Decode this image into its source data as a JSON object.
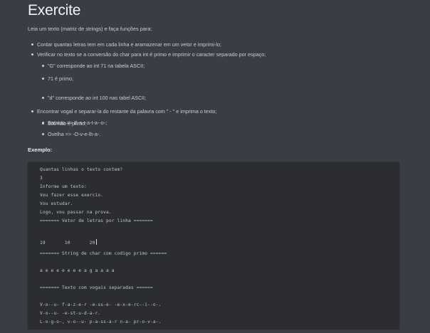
{
  "title": "Exercite",
  "intro": "Leia um texto (matriz de strings)  e faça funções para:",
  "bullets": {
    "b1": "Contar quantas letras tem em cada linha e aramazenar em um vetor e imprimi-lo;",
    "b2": "Verificar no texto se a conversão do char para int é primo e imprimir o caracter separado por espaço;",
    "b2_sub1": "\"G\" corresponde ao int 71 na tabela ASCII;",
    "b2_sub2": "71 é primo;",
    "b2_sub3": "\"d\" corresponde ao int 100 nas tabel ASCII;",
    "b2_sub4": "100 não é primo;",
    "b3": "Encontrar vogal e separar-la do restante da palavra com \" - \" e imprima o texto;",
    "b3_sub1": "Batatao => B-a-t-a-t-a--o-;",
    "b3_sub2": "Ovelha => -O-v-e-lh-a-."
  },
  "example_label": "Exemplo:",
  "code": {
    "l1": "Quantas linhas o texto contem?",
    "l2": "3",
    "l3": "Informe um texto:",
    "l4": "Vou fazer esse exercio.",
    "l5": "Vou estudar.",
    "l6": "Logo, vou passar na prova.",
    "l7": "======= Vetor de letras por linha =======",
    "l8": "19       10       20",
    "l9": "======= String de char com codigo primo ======",
    "l10": "a e e e e e e e a g a a a a",
    "l11": "======= Texto com vogais separadas ======",
    "l12": "V-o--u- f-a-z-e-r -e-ss-e- -e-x-e-rc--i--o-.",
    "l13": "V-o--u- -e-st-u-d-a-r.",
    "l14": "L-o-g-o-, v-o--u- p-a-ss-a-r n-a- pr-o-v-a-."
  }
}
